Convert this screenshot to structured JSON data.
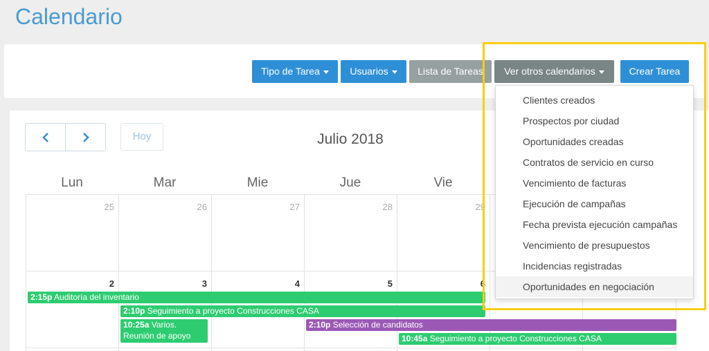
{
  "page": {
    "title": "Calendario"
  },
  "toolbar": {
    "task_type": "Tipo de Tarea",
    "users": "Usuarios",
    "task_list": "Lista de Tareas",
    "other_calendars": "Ver otros calendarios",
    "create_task": "Crear Tarea"
  },
  "calendar": {
    "prev_icon": "chevron-left-icon",
    "next_icon": "chevron-right-icon",
    "today": "Hoy",
    "month": "Julio 2018",
    "weekdays": [
      "Lun",
      "Mar",
      "Mie",
      "Jue",
      "Vie"
    ],
    "week1_days": [
      "25",
      "26",
      "27",
      "28",
      "29"
    ],
    "week2_days": [
      "2",
      "3",
      "4",
      "5",
      "6"
    ],
    "events": [
      {
        "time": "2:15p",
        "title": "Auditoría del inventario",
        "color": "#2ecc71"
      },
      {
        "time": "2:10p",
        "title": "Seguimiento a proyecto Construcciones CASA",
        "color": "#2ecc71"
      },
      {
        "time": "10:25a",
        "title": "Varios.",
        "title2": "Reunión de apoyo",
        "color": "#2ecc71"
      },
      {
        "time": "2:10p",
        "title": "Selección de candidatos",
        "color": "#9b59b6"
      },
      {
        "time": "10:45a",
        "title": "Seguimiento a proyecto Construcciones CASA",
        "color": "#2ecc71"
      }
    ]
  },
  "dropdown": {
    "items": [
      "Clientes creados",
      "Prospectos por ciudad",
      "Oportunidades creadas",
      "Contratos de servicio en curso",
      "Vencimiento de facturas",
      "Ejecución de campañas",
      "Fecha prevista ejecución campañas",
      "Vencimiento de presupuestos",
      "Incidencias registradas",
      "Oportunidades en negociación"
    ]
  },
  "colors": {
    "accent": "#2f8fd6",
    "highlight": "#f7ce0e",
    "event_green": "#2ecc71",
    "event_purple": "#9b59b6"
  }
}
